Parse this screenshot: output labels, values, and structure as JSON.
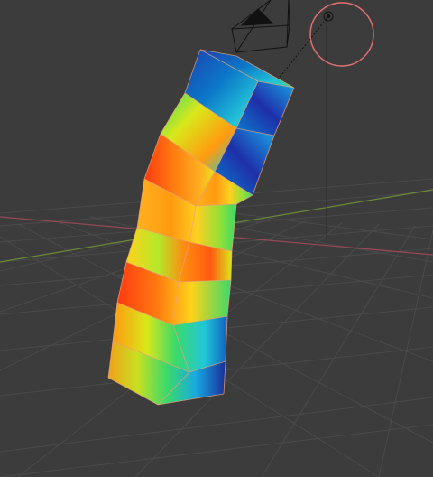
{
  "editor": {
    "type": "3d-viewport",
    "shading_mode": "weight-paint",
    "background_color": "#3c3c3c",
    "grid_line_color": "#4a4a4a",
    "x_axis_color": "#9a4a55",
    "y_axis_color": "#6a8a3a",
    "z_axis_color": "#7a7a7a"
  },
  "objects": {
    "mesh": {
      "name": "weight-painted-column",
      "edge_color": "#e8a47a"
    },
    "camera": {
      "name": "camera-object",
      "line_color": "#111111"
    },
    "light": {
      "name": "light-object",
      "circle_color": "#e07070",
      "line_color": "#111111"
    }
  },
  "weight_gradient": [
    "#1f2fa8",
    "#0a7fd0",
    "#20d0d0",
    "#3bd96a",
    "#d8e81a",
    "#ff9a10",
    "#ff3a10"
  ]
}
